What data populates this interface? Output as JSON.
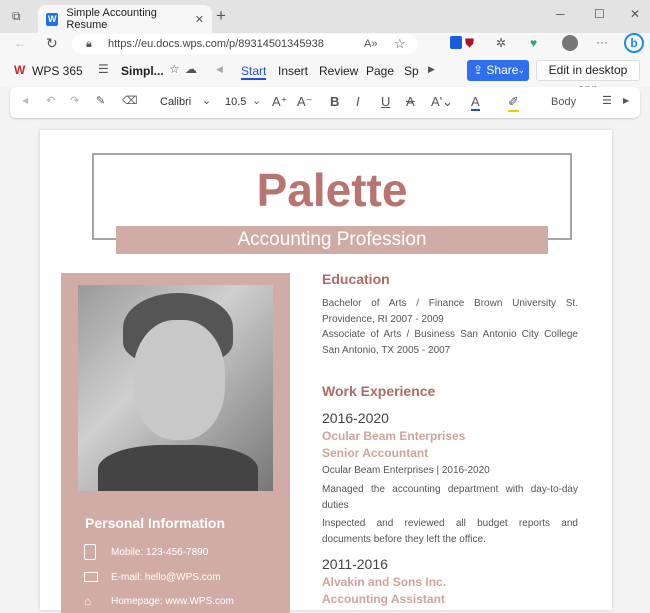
{
  "browser": {
    "tab_title": "Simple Accounting Resume",
    "url": "https://eu.docs.wps.com/p/89314501345938",
    "new_tab": "+"
  },
  "wps": {
    "brand": "WPS 365",
    "doc_name": "Simpl...",
    "tabs": [
      "Start",
      "Insert",
      "Review",
      "Page",
      "Sp"
    ],
    "active_tab": "Start",
    "share": "Share",
    "edit_desktop": "Edit in desktop app"
  },
  "format": {
    "font": "Calibri",
    "size": "10.5",
    "style": "Body"
  },
  "resume": {
    "title": "Palette",
    "subtitle": "Accounting Profession",
    "personal": {
      "heading": "Personal Information",
      "mobile": "Mobile: 123-456-7890",
      "email": "E-mail: hello@WPS.com",
      "homepage": "Homepage: www.WPS.com"
    },
    "education": {
      "heading": "Education",
      "lines": [
        "Bachelor of Arts / Finance Brown University St. Providence, RI 2007 - 2009",
        "Associate of Arts / Business San Antonio City College San Antonio, TX 2005 - 2007"
      ]
    },
    "work": {
      "heading": "Work Experience",
      "jobs": [
        {
          "years": "2016-2020",
          "company": "Ocular Beam Enterprises",
          "role": "Senior Accountant",
          "detail": "Ocular Beam Enterprises | 2016-2020",
          "duties": [
            "Managed the accounting department with day-to-day duties",
            "Inspected and reviewed all budget reports and documents before they left the office."
          ]
        },
        {
          "years": "2011-2016",
          "company": "Alvakin and Sons Inc.",
          "role": "Accounting Assistant"
        }
      ]
    }
  }
}
